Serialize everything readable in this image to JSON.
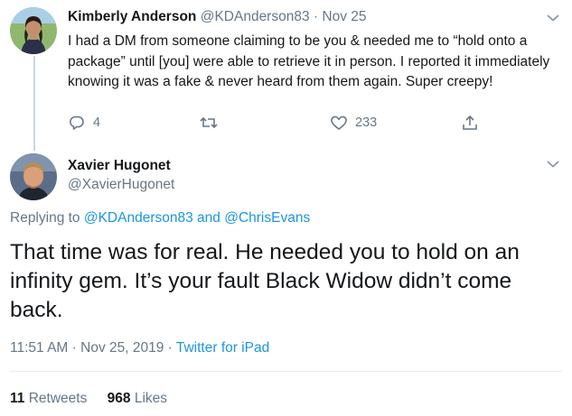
{
  "parent_tweet": {
    "author_name": "Kimberly Anderson",
    "author_handle": "@KDAnderson83",
    "separator": "·",
    "date": "Nov 25",
    "text": "I had a DM from someone claiming to be you & needed me to “hold onto a package” until [you] were able to retrieve it in person. I reported it immediately knowing it was a fake & never heard from them again. Super creepy!",
    "reply_count": "4",
    "like_count": "233",
    "icons": {
      "reply": "reply-icon",
      "retweet": "retweet-icon",
      "like": "heart-icon",
      "share": "share-icon",
      "menu": "chevron-down-icon"
    }
  },
  "main_tweet": {
    "author_name": "Xavier Hugonet",
    "author_handle": "@XavierHugonet",
    "replying_prefix": "Replying to",
    "replying_mention_1": "@KDAnderson83",
    "replying_and": "and",
    "replying_mention_2": "@ChrisEvans",
    "text": "That time was for real. He needed you to hold on an infinity gem. It’s your fault Black Widow didn’t come back.",
    "time": "11:51 AM",
    "meta_sep": "·",
    "full_date": "Nov 25, 2019",
    "source": "Twitter for iPad",
    "retweets_count": "11",
    "retweets_label": "Retweets",
    "likes_count": "968",
    "likes_label": "Likes"
  },
  "colors": {
    "text_primary": "#14171a",
    "text_secondary": "#657786",
    "link": "#1b95e0",
    "divider": "#e6ecf0",
    "thread_line": "#ccd6dd"
  }
}
